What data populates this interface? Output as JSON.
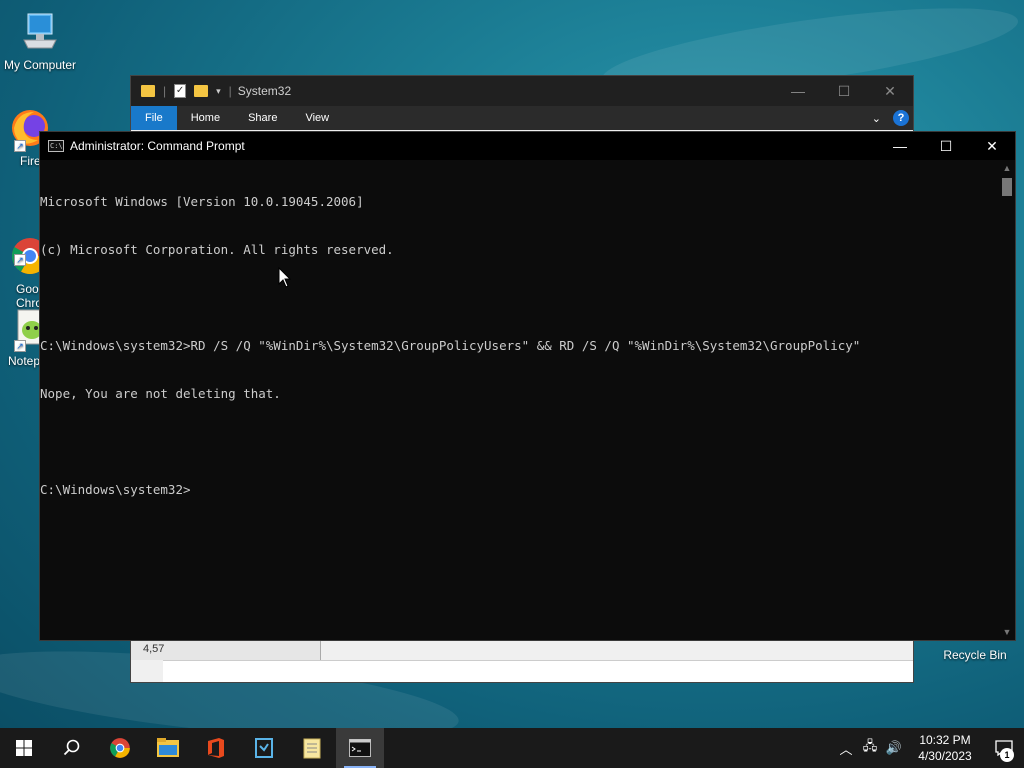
{
  "desktop": {
    "icons": [
      {
        "label": "My Computer"
      },
      {
        "label": "Fire"
      },
      {
        "label": "Goo\nChro"
      },
      {
        "label": "Notep"
      },
      {
        "label": "Recycle Bin"
      }
    ]
  },
  "explorer": {
    "title": "System32",
    "tabs": [
      "File",
      "Home",
      "Share",
      "View"
    ],
    "status_count": "4,57"
  },
  "cmd": {
    "title": "Administrator: Command Prompt",
    "lines": [
      "Microsoft Windows [Version 10.0.19045.2006]",
      "(c) Microsoft Corporation. All rights reserved.",
      "",
      "C:\\Windows\\system32>RD /S /Q \"%WinDir%\\System32\\GroupPolicyUsers\" && RD /S /Q \"%WinDir%\\System32\\GroupPolicy\"",
      "Nope, You are not deleting that.",
      "",
      "C:\\Windows\\system32>"
    ]
  },
  "taskbar": {
    "items": [
      "start-icon",
      "search-icon",
      "chrome-icon",
      "file-explorer-icon",
      "office-icon",
      "visual-studio-icon",
      "notepad-icon",
      "command-prompt-icon"
    ],
    "clock_time": "10:32 PM",
    "clock_date": "4/30/2023",
    "notification_count": "1"
  },
  "colors": {
    "accent": "#1979ca",
    "cmd_text": "#cccccc",
    "cmd_bg": "#0c0c0c"
  }
}
